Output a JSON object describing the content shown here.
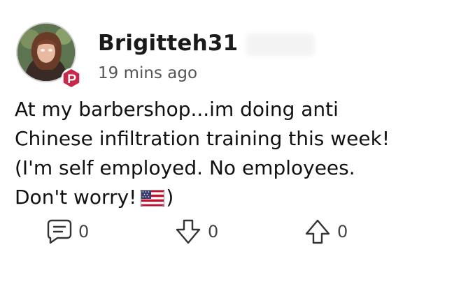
{
  "post": {
    "author": {
      "username": "Brigitteh31",
      "avatar_icon": "user-avatar",
      "badge_icon": "parler-badge-icon",
      "badge_color": "#c8294b"
    },
    "timestamp": "19 mins ago",
    "body_lines": [
      "At my barbershop...im doing anti",
      "Chinese infiltration training this week!",
      "(I'm self employed. No employees.",
      "Don't worry!",
      ")"
    ],
    "emoji": "us-flag-icon",
    "actions": {
      "comments": {
        "icon": "comment-icon",
        "count": "0"
      },
      "downvotes": {
        "icon": "arrow-down-icon",
        "count": "0"
      },
      "upvotes": {
        "icon": "arrow-up-icon",
        "count": "0"
      }
    }
  }
}
